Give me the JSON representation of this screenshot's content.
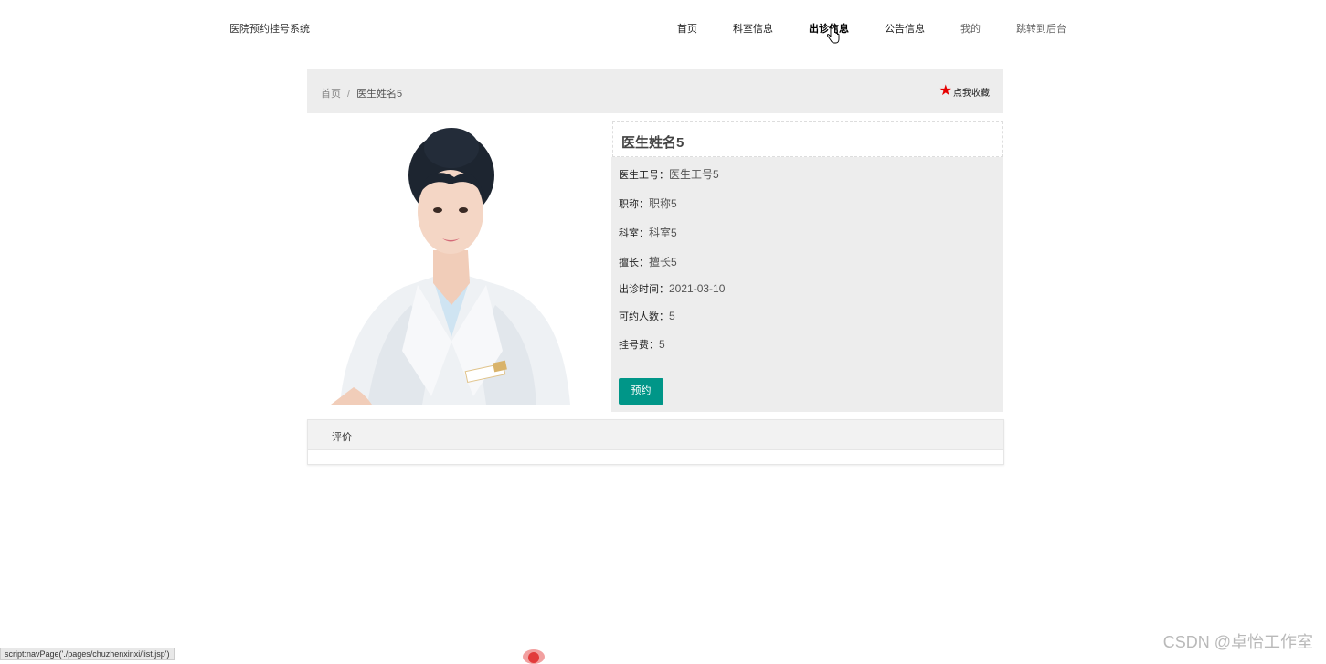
{
  "header": {
    "brand": "医院预约挂号系统",
    "nav": [
      {
        "label": "首页"
      },
      {
        "label": "科室信息"
      },
      {
        "label": "出诊信息"
      },
      {
        "label": "公告信息"
      },
      {
        "label": "我的"
      },
      {
        "label": "跳转到后台"
      }
    ]
  },
  "breadcrumb": {
    "home": "首页",
    "separator": "/",
    "current": "医生姓名5",
    "favorite": "点我收藏"
  },
  "detail": {
    "title": "医生姓名5",
    "fields": [
      {
        "label": "医生工号：",
        "value": "医生工号5"
      },
      {
        "label": "职称：",
        "value": "职称5"
      },
      {
        "label": "科室：",
        "value": "科室5"
      },
      {
        "label": "擅长：",
        "value": "擅长5"
      },
      {
        "label": "出诊时间：",
        "value": "2021-03-10"
      },
      {
        "label": "可约人数：",
        "value": "5"
      },
      {
        "label": "挂号费：",
        "value": "5"
      }
    ],
    "book_button": "预约"
  },
  "review": {
    "title": "评价"
  },
  "status_bar": {
    "text": "script:navPage('./pages/chuzhenxinxi/list.jsp')"
  },
  "watermark": "CSDN @卓怡工作室",
  "colors": {
    "accent": "#009688",
    "favorite_star": "#e60000",
    "panel_bg": "#ededed"
  }
}
